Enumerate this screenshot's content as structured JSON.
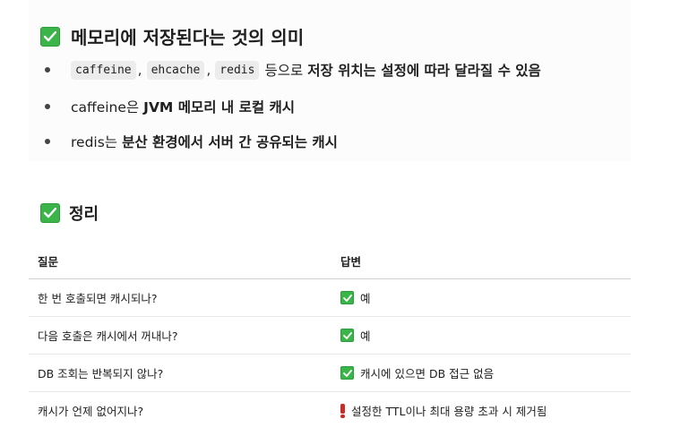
{
  "section1": {
    "title": "메모리에 저장된다는 것의 의미",
    "bullets": [
      {
        "codes": [
          "caffeine",
          "ehcache",
          "redis"
        ],
        "separator": ",",
        "plain": "등으로",
        "bold": "저장 위치는 설정에 따라 달라질 수 있음"
      },
      {
        "plain": "caffeine은",
        "bold": "JVM 메모리 내 로컬 캐시"
      },
      {
        "plain": "redis는",
        "bold": "분산 환경에서 서버 간 공유되는 캐시"
      }
    ]
  },
  "section2": {
    "title": "정리",
    "table": {
      "headers": [
        "질문",
        "답변"
      ],
      "rows": [
        {
          "question": "한 번 호출되면 캐시되나?",
          "answer_icon": "check-icon",
          "answer": "예"
        },
        {
          "question": "다음 호출은 캐시에서 꺼내나?",
          "answer_icon": "check-icon",
          "answer": "예"
        },
        {
          "question": "DB 조회는 반복되지 않나?",
          "answer_icon": "check-icon",
          "answer": "캐시에 있으면 DB 접근 없음"
        },
        {
          "question": "캐시가 언제 없어지나?",
          "answer_icon": "exclamation-icon",
          "answer": "설정한 TTL이나 최대 용량 초과 시 제거됨"
        }
      ]
    }
  },
  "colors": {
    "check_green": "#3bb54a",
    "exclamation_red": "#c92a2a",
    "code_bg": "#ececec"
  }
}
